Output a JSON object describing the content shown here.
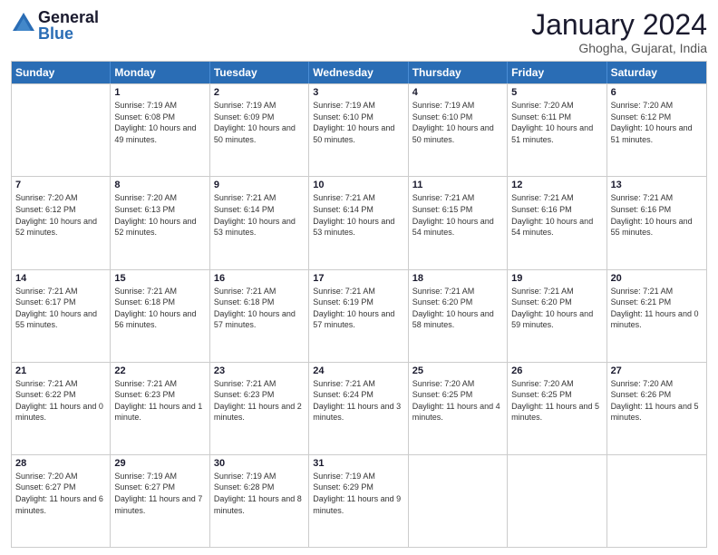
{
  "logo": {
    "general": "General",
    "blue": "Blue"
  },
  "header": {
    "title": "January 2024",
    "subtitle": "Ghogha, Gujarat, India"
  },
  "weekdays": [
    "Sunday",
    "Monday",
    "Tuesday",
    "Wednesday",
    "Thursday",
    "Friday",
    "Saturday"
  ],
  "weeks": [
    [
      {
        "day": "",
        "sunrise": "",
        "sunset": "",
        "daylight": ""
      },
      {
        "day": "1",
        "sunrise": "Sunrise: 7:19 AM",
        "sunset": "Sunset: 6:08 PM",
        "daylight": "Daylight: 10 hours and 49 minutes."
      },
      {
        "day": "2",
        "sunrise": "Sunrise: 7:19 AM",
        "sunset": "Sunset: 6:09 PM",
        "daylight": "Daylight: 10 hours and 50 minutes."
      },
      {
        "day": "3",
        "sunrise": "Sunrise: 7:19 AM",
        "sunset": "Sunset: 6:10 PM",
        "daylight": "Daylight: 10 hours and 50 minutes."
      },
      {
        "day": "4",
        "sunrise": "Sunrise: 7:19 AM",
        "sunset": "Sunset: 6:10 PM",
        "daylight": "Daylight: 10 hours and 50 minutes."
      },
      {
        "day": "5",
        "sunrise": "Sunrise: 7:20 AM",
        "sunset": "Sunset: 6:11 PM",
        "daylight": "Daylight: 10 hours and 51 minutes."
      },
      {
        "day": "6",
        "sunrise": "Sunrise: 7:20 AM",
        "sunset": "Sunset: 6:12 PM",
        "daylight": "Daylight: 10 hours and 51 minutes."
      }
    ],
    [
      {
        "day": "7",
        "sunrise": "Sunrise: 7:20 AM",
        "sunset": "Sunset: 6:12 PM",
        "daylight": "Daylight: 10 hours and 52 minutes."
      },
      {
        "day": "8",
        "sunrise": "Sunrise: 7:20 AM",
        "sunset": "Sunset: 6:13 PM",
        "daylight": "Daylight: 10 hours and 52 minutes."
      },
      {
        "day": "9",
        "sunrise": "Sunrise: 7:21 AM",
        "sunset": "Sunset: 6:14 PM",
        "daylight": "Daylight: 10 hours and 53 minutes."
      },
      {
        "day": "10",
        "sunrise": "Sunrise: 7:21 AM",
        "sunset": "Sunset: 6:14 PM",
        "daylight": "Daylight: 10 hours and 53 minutes."
      },
      {
        "day": "11",
        "sunrise": "Sunrise: 7:21 AM",
        "sunset": "Sunset: 6:15 PM",
        "daylight": "Daylight: 10 hours and 54 minutes."
      },
      {
        "day": "12",
        "sunrise": "Sunrise: 7:21 AM",
        "sunset": "Sunset: 6:16 PM",
        "daylight": "Daylight: 10 hours and 54 minutes."
      },
      {
        "day": "13",
        "sunrise": "Sunrise: 7:21 AM",
        "sunset": "Sunset: 6:16 PM",
        "daylight": "Daylight: 10 hours and 55 minutes."
      }
    ],
    [
      {
        "day": "14",
        "sunrise": "Sunrise: 7:21 AM",
        "sunset": "Sunset: 6:17 PM",
        "daylight": "Daylight: 10 hours and 55 minutes."
      },
      {
        "day": "15",
        "sunrise": "Sunrise: 7:21 AM",
        "sunset": "Sunset: 6:18 PM",
        "daylight": "Daylight: 10 hours and 56 minutes."
      },
      {
        "day": "16",
        "sunrise": "Sunrise: 7:21 AM",
        "sunset": "Sunset: 6:18 PM",
        "daylight": "Daylight: 10 hours and 57 minutes."
      },
      {
        "day": "17",
        "sunrise": "Sunrise: 7:21 AM",
        "sunset": "Sunset: 6:19 PM",
        "daylight": "Daylight: 10 hours and 57 minutes."
      },
      {
        "day": "18",
        "sunrise": "Sunrise: 7:21 AM",
        "sunset": "Sunset: 6:20 PM",
        "daylight": "Daylight: 10 hours and 58 minutes."
      },
      {
        "day": "19",
        "sunrise": "Sunrise: 7:21 AM",
        "sunset": "Sunset: 6:20 PM",
        "daylight": "Daylight: 10 hours and 59 minutes."
      },
      {
        "day": "20",
        "sunrise": "Sunrise: 7:21 AM",
        "sunset": "Sunset: 6:21 PM",
        "daylight": "Daylight: 11 hours and 0 minutes."
      }
    ],
    [
      {
        "day": "21",
        "sunrise": "Sunrise: 7:21 AM",
        "sunset": "Sunset: 6:22 PM",
        "daylight": "Daylight: 11 hours and 0 minutes."
      },
      {
        "day": "22",
        "sunrise": "Sunrise: 7:21 AM",
        "sunset": "Sunset: 6:23 PM",
        "daylight": "Daylight: 11 hours and 1 minute."
      },
      {
        "day": "23",
        "sunrise": "Sunrise: 7:21 AM",
        "sunset": "Sunset: 6:23 PM",
        "daylight": "Daylight: 11 hours and 2 minutes."
      },
      {
        "day": "24",
        "sunrise": "Sunrise: 7:21 AM",
        "sunset": "Sunset: 6:24 PM",
        "daylight": "Daylight: 11 hours and 3 minutes."
      },
      {
        "day": "25",
        "sunrise": "Sunrise: 7:20 AM",
        "sunset": "Sunset: 6:25 PM",
        "daylight": "Daylight: 11 hours and 4 minutes."
      },
      {
        "day": "26",
        "sunrise": "Sunrise: 7:20 AM",
        "sunset": "Sunset: 6:25 PM",
        "daylight": "Daylight: 11 hours and 5 minutes."
      },
      {
        "day": "27",
        "sunrise": "Sunrise: 7:20 AM",
        "sunset": "Sunset: 6:26 PM",
        "daylight": "Daylight: 11 hours and 5 minutes."
      }
    ],
    [
      {
        "day": "28",
        "sunrise": "Sunrise: 7:20 AM",
        "sunset": "Sunset: 6:27 PM",
        "daylight": "Daylight: 11 hours and 6 minutes."
      },
      {
        "day": "29",
        "sunrise": "Sunrise: 7:19 AM",
        "sunset": "Sunset: 6:27 PM",
        "daylight": "Daylight: 11 hours and 7 minutes."
      },
      {
        "day": "30",
        "sunrise": "Sunrise: 7:19 AM",
        "sunset": "Sunset: 6:28 PM",
        "daylight": "Daylight: 11 hours and 8 minutes."
      },
      {
        "day": "31",
        "sunrise": "Sunrise: 7:19 AM",
        "sunset": "Sunset: 6:29 PM",
        "daylight": "Daylight: 11 hours and 9 minutes."
      },
      {
        "day": "",
        "sunrise": "",
        "sunset": "",
        "daylight": ""
      },
      {
        "day": "",
        "sunrise": "",
        "sunset": "",
        "daylight": ""
      },
      {
        "day": "",
        "sunrise": "",
        "sunset": "",
        "daylight": ""
      }
    ]
  ]
}
